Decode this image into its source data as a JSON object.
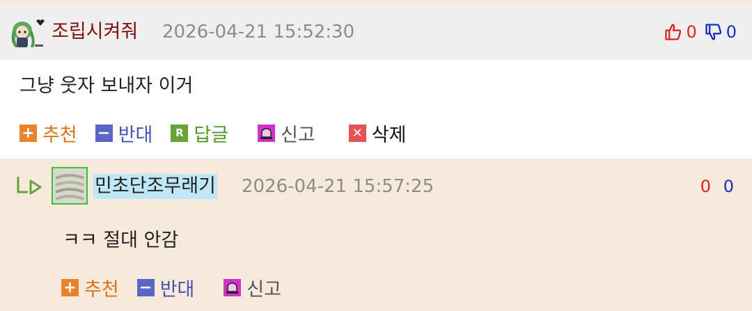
{
  "comment": {
    "author": "조립시켜줘",
    "date": "2026-04-21 15:52:30",
    "likes": "0",
    "dislikes": "0",
    "text": "그냥 웃자 보내자 이거",
    "actions": {
      "recommend": "추천",
      "oppose": "반대",
      "reply": "답글",
      "report": "신고",
      "delete": "삭제"
    }
  },
  "reply": {
    "author": "민초단조무래기",
    "date": "2026-04-21 15:57:25",
    "likes": "0",
    "dislikes": "0",
    "text": "ㅋㅋ 절대 안감",
    "actions": {
      "recommend": "추천",
      "oppose": "반대",
      "report": "신고"
    }
  },
  "icons": {
    "thumbs_up": "thumbs-up-icon",
    "thumbs_down": "thumbs-down-icon",
    "reply_arrow": "reply-arrow-icon"
  },
  "colors": {
    "author1": "#7a1010",
    "like": "#dd2222",
    "dislike": "#1a2fbf",
    "recommend": "#e8832a",
    "oppose": "#5a66c3",
    "reply": "#67a33a",
    "report": "#d431c8",
    "delete": "#e35454"
  }
}
